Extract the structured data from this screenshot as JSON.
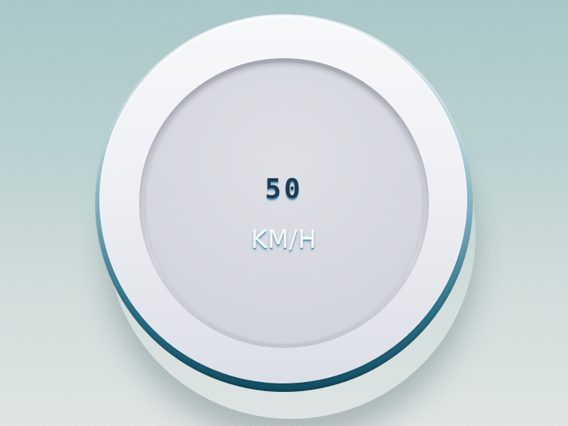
{
  "gauge": {
    "speed_value": "50",
    "speed_unit": "KM/H"
  },
  "colors": {
    "background_top": "#aac9cb",
    "background_bottom": "#e1e7e6",
    "rim_accent": "#14566d",
    "face": "#d6d8df",
    "value_text": "#1f3a52",
    "unit_text": "#f4f8fb"
  }
}
